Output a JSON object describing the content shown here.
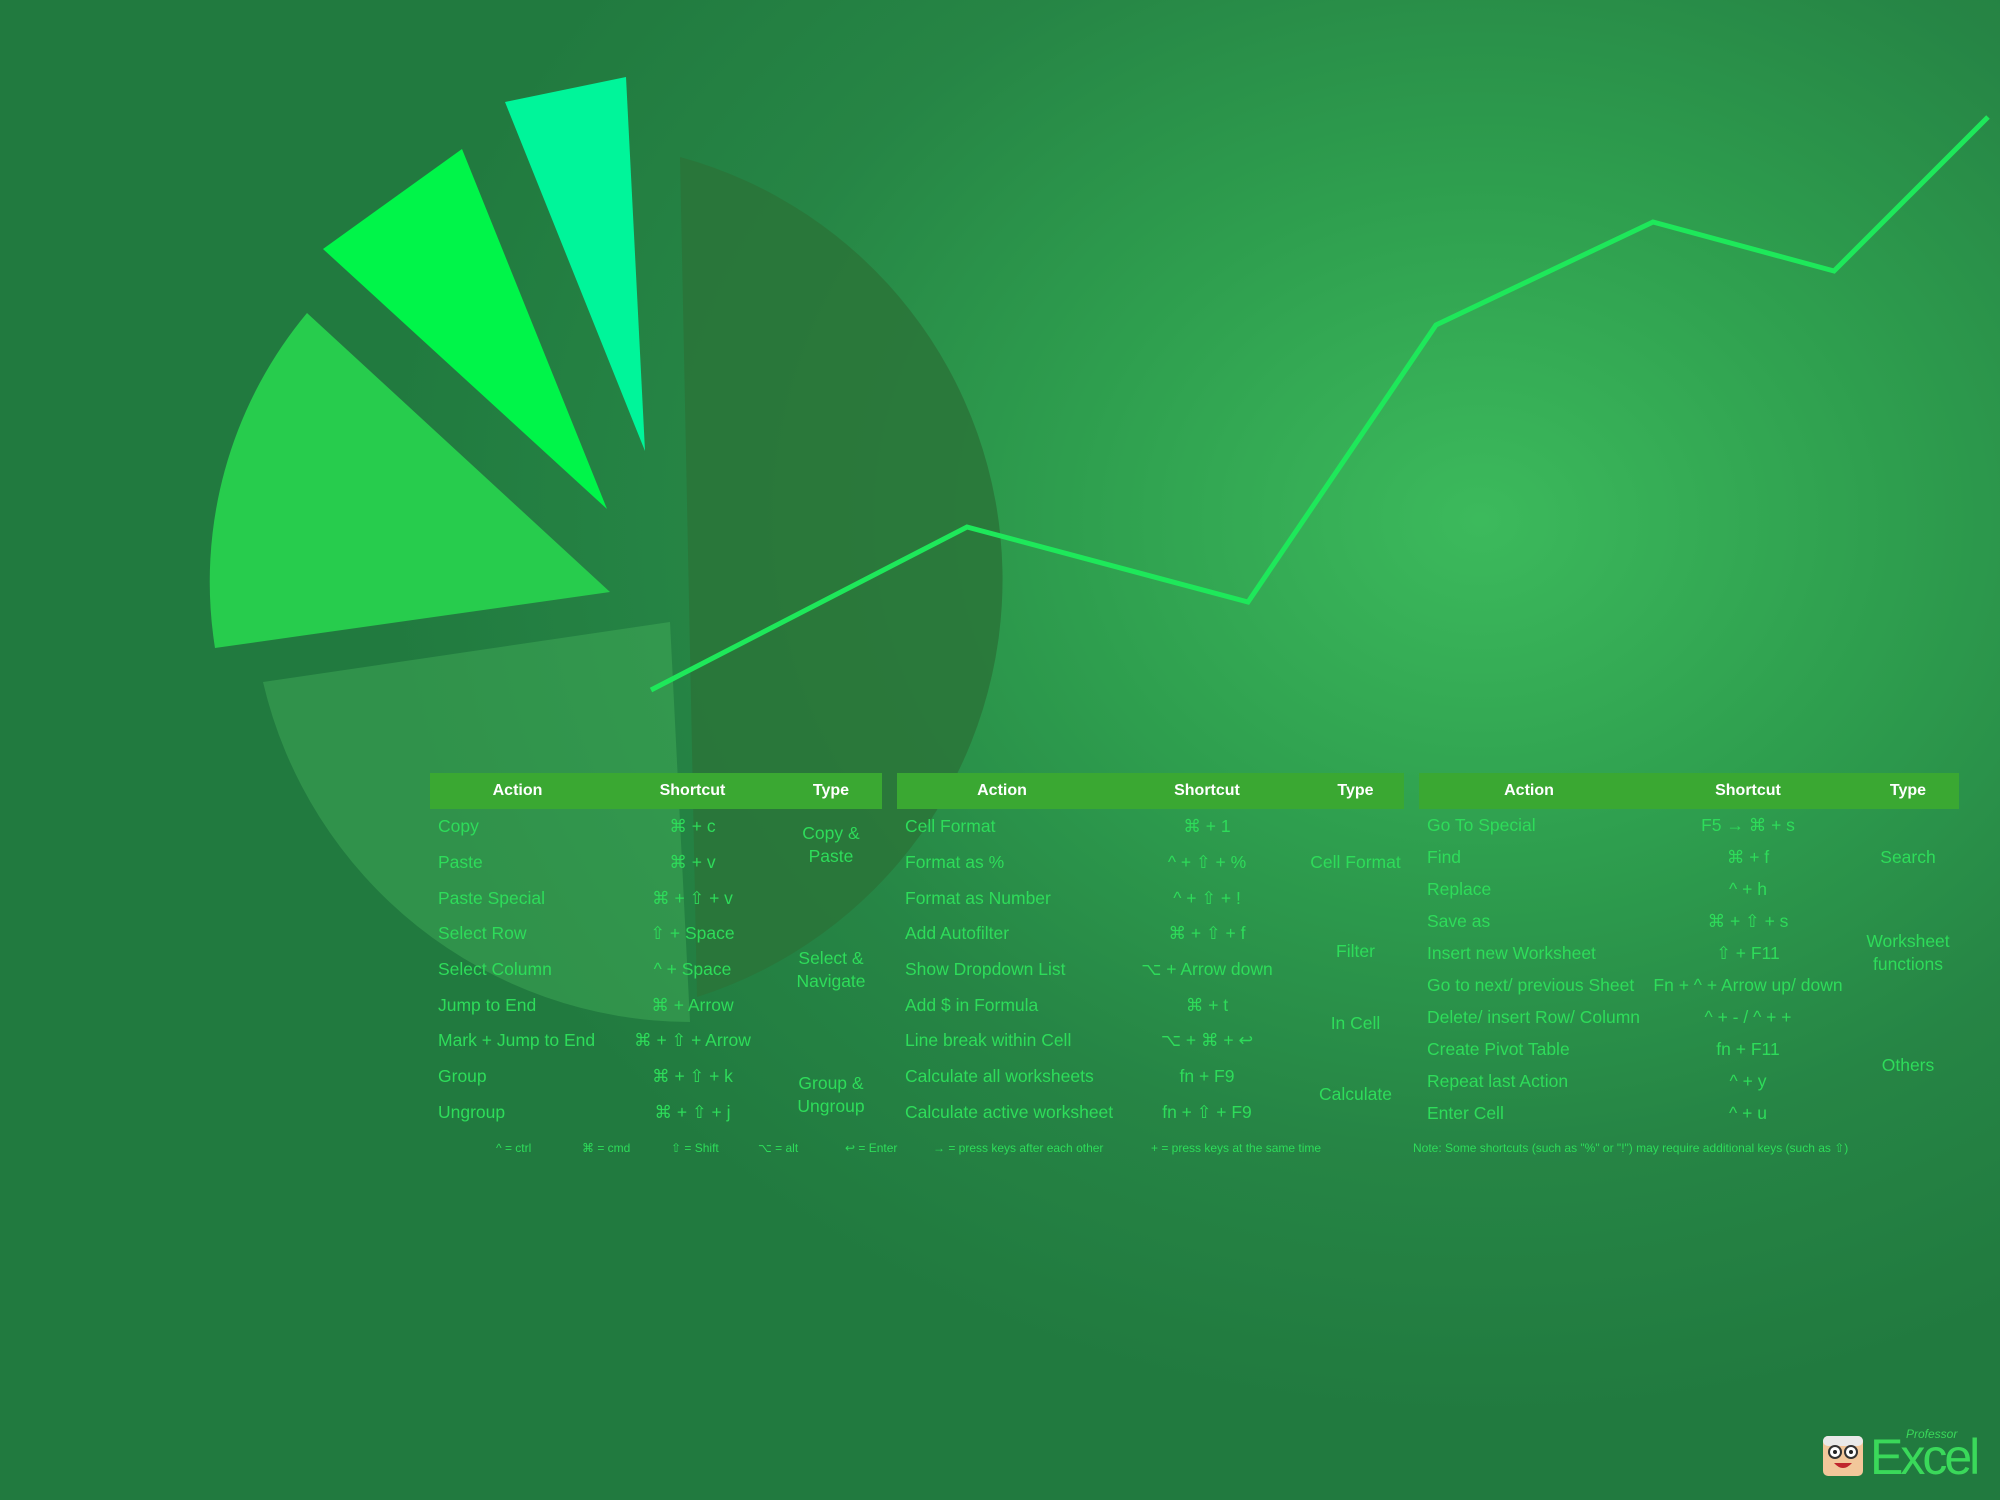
{
  "tables": [
    {
      "headers": {
        "action": "Action",
        "shortcut": "Shortcut",
        "type": "Type"
      },
      "rows": [
        {
          "action": "Copy",
          "shortcut": "⌘ + c"
        },
        {
          "action": "Paste",
          "shortcut": "⌘ + v"
        },
        {
          "action": "Paste Special",
          "shortcut": "⌘ + ⇧ + v"
        },
        {
          "action": "Select Row",
          "shortcut": "⇧ +  Space"
        },
        {
          "action": "Select Column",
          "shortcut": "^ + Space"
        },
        {
          "action": "Jump to End",
          "shortcut": "⌘ + Arrow"
        },
        {
          "action": "Mark + Jump to End",
          "shortcut": "⌘ + ⇧ + Arrow"
        },
        {
          "action": "Group",
          "shortcut": "⌘ + ⇧ + k"
        },
        {
          "action": "Ungroup",
          "shortcut": "⌘ + ⇧ + j"
        }
      ],
      "types": [
        "",
        "Copy & Paste",
        "",
        "Select & Navigate",
        "",
        "Group & Ungroup"
      ]
    },
    {
      "headers": {
        "action": "Action",
        "shortcut": "Shortcut",
        "type": "Type"
      },
      "rows": [
        {
          "action": "Cell Format",
          "shortcut": "⌘ + 1"
        },
        {
          "action": "Format as %",
          "shortcut": "^ + ⇧ + %"
        },
        {
          "action": "Format as Number",
          "shortcut": "^ + ⇧ + !"
        },
        {
          "action": "Add Autofilter",
          "shortcut": "⌘ + ⇧ + f"
        },
        {
          "action": "Show Dropdown List",
          "shortcut": "⌥ + Arrow down"
        },
        {
          "action": "Add $ in Formula",
          "shortcut": "⌘ + t"
        },
        {
          "action": "Line break within Cell",
          "shortcut": "⌥ + ⌘ + ↩"
        },
        {
          "action": "Calculate all worksheets",
          "shortcut": "fn + F9"
        },
        {
          "action": "Calculate active worksheet",
          "shortcut": "fn + ⇧ + F9"
        }
      ],
      "types": [
        "Cell Format",
        "Filter",
        "In Cell",
        "Calculate"
      ]
    },
    {
      "headers": {
        "action": "Action",
        "shortcut": "Shortcut",
        "type": "Type"
      },
      "rows": [
        {
          "action": "Go To Special",
          "shortcut": "F5 → ⌘ + s"
        },
        {
          "action": "Find",
          "shortcut": "⌘ + f"
        },
        {
          "action": "Replace",
          "shortcut": "^ + h"
        },
        {
          "action": "Save as",
          "shortcut": "⌘ + ⇧ + s"
        },
        {
          "action": "Insert new Worksheet",
          "shortcut": "⇧ + F11"
        },
        {
          "action": "Go to next/ previous Sheet",
          "shortcut": "Fn + ^ + Arrow up/ down"
        },
        {
          "action": "Delete/ insert Row/ Column",
          "shortcut": "^ + - / ^ + +"
        },
        {
          "action": "Create Pivot Table",
          "shortcut": "fn + F11"
        },
        {
          "action": "Repeat last Action",
          "shortcut": "^ + y"
        },
        {
          "action": "Enter Cell",
          "shortcut": "^ + u"
        }
      ],
      "types": [
        "Search",
        "Worksheet functions",
        "Others"
      ]
    }
  ],
  "legend": [
    "^ = ctrl",
    "⌘ = cmd",
    "⇧ = Shift",
    "⌥ = alt",
    "↩ = Enter",
    "→ =  press keys after each other",
    "+ = press keys at the same time"
  ],
  "note": "Note: Some shortcuts (such as \"%\" or \"!\") may require additional keys (such as ⇧)",
  "logo": {
    "word": "Excel",
    "sub": "Professor"
  },
  "colors": {
    "background": "#2e9e4e",
    "header": "#3aa832",
    "text": "#2edc5a",
    "line": "#1ee85a"
  }
}
